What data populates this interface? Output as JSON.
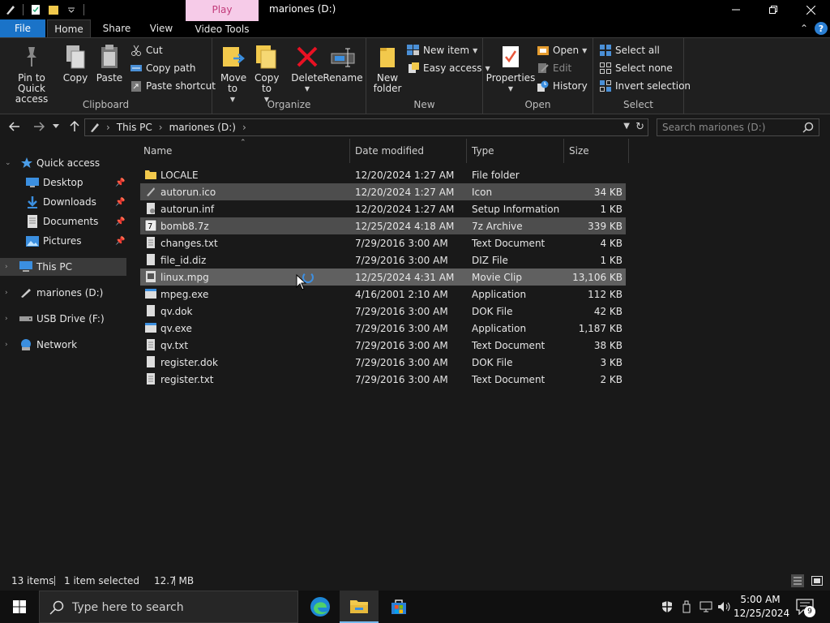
{
  "window": {
    "title": "mariones (D:)",
    "contextual_tab_group": "Play"
  },
  "tabs": {
    "file": "File",
    "home": "Home",
    "share": "Share",
    "view": "View",
    "video_tools": "Video Tools"
  },
  "help_label": "?",
  "ribbon": {
    "clipboard": {
      "label": "Clipboard",
      "pin": "Pin to Quick access",
      "copy": "Copy",
      "paste": "Paste",
      "cut": "Cut",
      "copy_path": "Copy path",
      "paste_shortcut": "Paste shortcut"
    },
    "organize": {
      "label": "Organize",
      "move_to": "Move to",
      "copy_to": "Copy to",
      "delete": "Delete",
      "rename": "Rename"
    },
    "new": {
      "label": "New",
      "new_folder": "New folder",
      "new_item": "New item",
      "easy_access": "Easy access"
    },
    "open": {
      "label": "Open",
      "properties": "Properties",
      "open": "Open",
      "edit": "Edit",
      "history": "History"
    },
    "select": {
      "label": "Select",
      "select_all": "Select all",
      "select_none": "Select none",
      "invert_selection": "Invert selection"
    }
  },
  "address": {
    "crumbs": [
      "This PC",
      "mariones (D:)"
    ],
    "search_placeholder": "Search mariones (D:)"
  },
  "nav_pane": {
    "quick_access": "Quick access",
    "desktop": "Desktop",
    "downloads": "Downloads",
    "documents": "Documents",
    "pictures": "Pictures",
    "this_pc": "This PC",
    "drive_d": "mariones (D:)",
    "usb": "USB Drive (F:)",
    "network": "Network"
  },
  "columns": {
    "name": "Name",
    "date": "Date modified",
    "type": "Type",
    "size": "Size"
  },
  "files": [
    {
      "name": "LOCALE",
      "date": "12/20/2024 1:27 AM",
      "type": "File folder",
      "size": "",
      "icon": "folder-icon"
    },
    {
      "name": "autorun.ico",
      "date": "12/20/2024 1:27 AM",
      "type": "Icon",
      "size": "34 KB",
      "icon": "ico-file-icon"
    },
    {
      "name": "autorun.inf",
      "date": "12/20/2024 1:27 AM",
      "type": "Setup Information",
      "size": "1 KB",
      "icon": "settings-file-icon"
    },
    {
      "name": "bomb8.7z",
      "date": "12/25/2024 4:18 AM",
      "type": "7z Archive",
      "size": "339 KB",
      "icon": "archive-icon"
    },
    {
      "name": "changes.txt",
      "date": "7/29/2016 3:00 AM",
      "type": "Text Document",
      "size": "4 KB",
      "icon": "text-file-icon"
    },
    {
      "name": "file_id.diz",
      "date": "7/29/2016 3:00 AM",
      "type": "DIZ File",
      "size": "1 KB",
      "icon": "generic-file-icon"
    },
    {
      "name": "linux.mpg",
      "date": "12/25/2024 4:31 AM",
      "type": "Movie Clip",
      "size": "13,106 KB",
      "icon": "video-file-icon"
    },
    {
      "name": "mpeg.exe",
      "date": "4/16/2001 2:10 AM",
      "type": "Application",
      "size": "112 KB",
      "icon": "application-icon"
    },
    {
      "name": "qv.dok",
      "date": "7/29/2016 3:00 AM",
      "type": "DOK File",
      "size": "42 KB",
      "icon": "generic-file-icon"
    },
    {
      "name": "qv.exe",
      "date": "7/29/2016 3:00 AM",
      "type": "Application",
      "size": "1,187 KB",
      "icon": "application-icon"
    },
    {
      "name": "qv.txt",
      "date": "7/29/2016 3:00 AM",
      "type": "Text Document",
      "size": "38 KB",
      "icon": "text-file-icon"
    },
    {
      "name": "register.dok",
      "date": "7/29/2016 3:00 AM",
      "type": "DOK File",
      "size": "3 KB",
      "icon": "generic-file-icon"
    },
    {
      "name": "register.txt",
      "date": "7/29/2016 3:00 AM",
      "type": "Text Document",
      "size": "2 KB",
      "icon": "text-file-icon"
    }
  ],
  "status": {
    "count": "13 items",
    "selection": "1 item selected",
    "selection_size": "12.7 MB"
  },
  "taskbar": {
    "search_placeholder": "Type here to search",
    "time": "5:00 AM",
    "date": "12/25/2024",
    "notification_count": "9"
  },
  "colors": {
    "accent": "#1a73c8",
    "contextual_tab": "#f6cbe8",
    "selected_row": "#606060",
    "folder": "#f2c94c"
  }
}
